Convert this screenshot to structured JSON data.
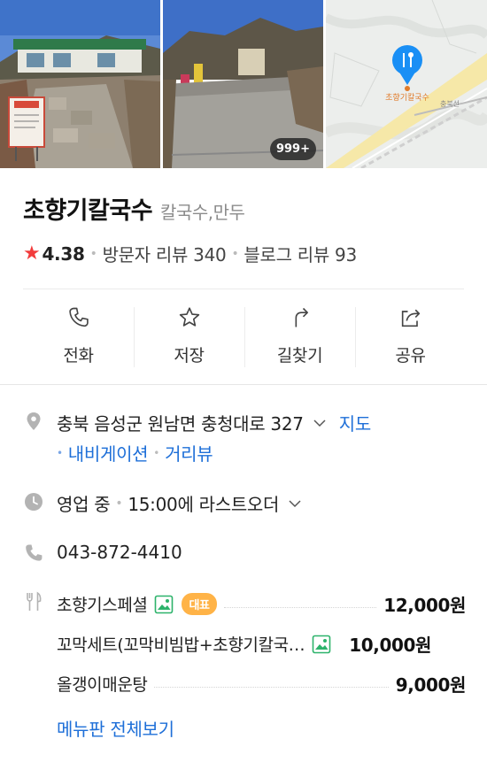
{
  "photos": {
    "count_badge": "999+",
    "map_label": "초향기칼국수",
    "map_road_label": "충북선"
  },
  "place": {
    "name": "초향기칼국수",
    "category": "칼국수,만두",
    "rating": "4.38",
    "visitor_reviews": "방문자 리뷰 340",
    "blog_reviews": "블로그 리뷰 93"
  },
  "actions": [
    {
      "label": "전화",
      "icon": "phone-icon"
    },
    {
      "label": "저장",
      "icon": "star-outline-icon"
    },
    {
      "label": "길찾기",
      "icon": "directions-icon"
    },
    {
      "label": "공유",
      "icon": "share-icon"
    }
  ],
  "address": {
    "text": "충북 음성군 원남면 충청대로 327",
    "map_link": "지도",
    "navigation_link": "내비게이션",
    "streetview_link": "거리뷰"
  },
  "hours": {
    "status": "영업 중",
    "last_order": "15:00에 라스트오더"
  },
  "phone": "043-872-4410",
  "menu": {
    "items": [
      {
        "name": "초향기스페셜",
        "price": "12,000원",
        "badge": "대표",
        "has_image": true
      },
      {
        "name": "꼬막세트(꼬막비빔밥+초향기칼국…",
        "price": "10,000원",
        "has_image": true
      },
      {
        "name": "올갱이매운탕",
        "price": "9,000원",
        "has_image": false
      }
    ],
    "view_all": "메뉴판 전체보기"
  },
  "colors": {
    "accent_blue": "#1e6fd8",
    "star_red": "#f23c3c",
    "badge_orange": "#ffb347",
    "image_icon_green": "#2db36b"
  }
}
